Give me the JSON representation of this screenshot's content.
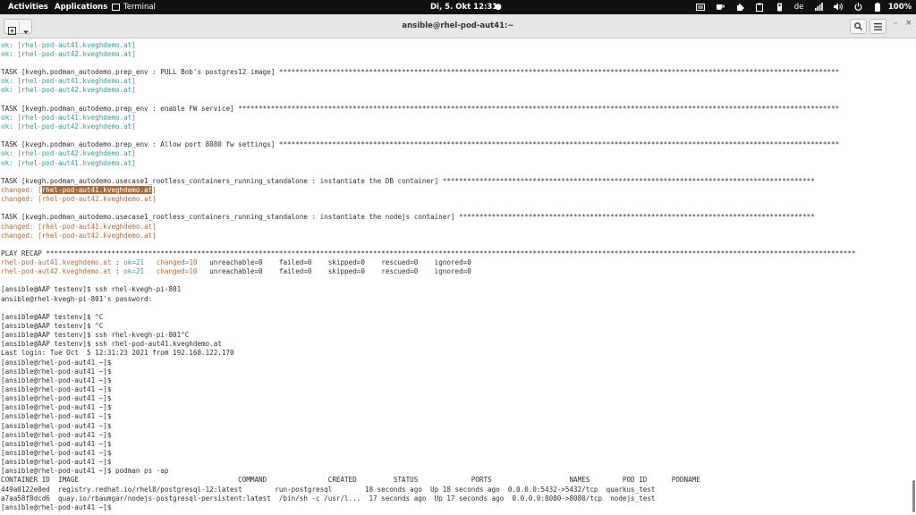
{
  "topbar": {
    "activities": "Activities",
    "applications": "Applications",
    "terminal": "Terminal",
    "clock": "Di, 5. Okt  12:31",
    "dot": "●",
    "lang": "de",
    "battery": "100%"
  },
  "window": {
    "title": "ansible@rhel-pod-aut41:~"
  },
  "terminal": {
    "lines": [
      {
        "segs": [
          {
            "t": "ok: [rhel-pod-aut41.kveghdemo.at]",
            "c": "green"
          }
        ]
      },
      {
        "segs": [
          {
            "t": "ok: [rhel-pod-aut42.kveghdemo.at]",
            "c": "green"
          }
        ]
      },
      {
        "segs": [
          {
            "t": ""
          }
        ]
      },
      {
        "segs": [
          {
            "t": "TASK [kvegh.podman_autodemo.prep_env : PULL Bob's postgres12 image] *****************************************************************************************************************************************"
          }
        ]
      },
      {
        "segs": [
          {
            "t": "ok: [rhel-pod-aut41.kveghdemo.at]",
            "c": "green"
          }
        ]
      },
      {
        "segs": [
          {
            "t": "ok: [rhel-pod-aut42.kveghdemo.at]",
            "c": "green"
          }
        ]
      },
      {
        "segs": [
          {
            "t": ""
          }
        ]
      },
      {
        "segs": [
          {
            "t": "TASK [kvegh.podman_autodemo.prep_env : enable FW service] ***************************************************************************************************************************************************"
          }
        ]
      },
      {
        "segs": [
          {
            "t": "ok: [rhel-pod-aut41.kveghdemo.at]",
            "c": "green"
          }
        ]
      },
      {
        "segs": [
          {
            "t": "ok: [rhel-pod-aut42.kveghdemo.at]",
            "c": "green"
          }
        ]
      },
      {
        "segs": [
          {
            "t": ""
          }
        ]
      },
      {
        "segs": [
          {
            "t": "TASK [kvegh.podman_autodemo.prep_env : Allow port 8080 fw settings] *****************************************************************************************************************************************"
          }
        ]
      },
      {
        "segs": [
          {
            "t": "ok: [rhel-pod-aut42.kveghdemo.at]",
            "c": "green"
          }
        ]
      },
      {
        "segs": [
          {
            "t": "ok: [rhel-pod-aut41.kveghdemo.at]",
            "c": "green"
          }
        ]
      },
      {
        "segs": [
          {
            "t": ""
          }
        ]
      },
      {
        "segs": [
          {
            "t": "TASK [kvegh.podman_autodemo.usecase1_rootless_containers_running_standalone : instantiate the DB container] *******************************************************************************************"
          }
        ]
      },
      {
        "segs": [
          {
            "t": "changed: [",
            "c": "brown"
          },
          {
            "t": "rhel-pod-aut41.kveghdemo.at",
            "c": "sel"
          },
          {
            "t": "]",
            "c": "brown"
          }
        ]
      },
      {
        "segs": [
          {
            "t": "changed: [rhel-pod-aut42.kveghdemo.at]",
            "c": "brown"
          }
        ]
      },
      {
        "segs": [
          {
            "t": ""
          }
        ]
      },
      {
        "segs": [
          {
            "t": "TASK [kvegh.podman_autodemo.usecase1_rootless_containers_running_standalone : instantiate the nodejs container] ***************************************************************************************"
          }
        ]
      },
      {
        "segs": [
          {
            "t": "changed: [rhel-pod-aut41.kveghdemo.at]",
            "c": "brown"
          }
        ]
      },
      {
        "segs": [
          {
            "t": "changed: [rhel-pod-aut42.kveghdemo.at]",
            "c": "brown"
          }
        ]
      },
      {
        "segs": [
          {
            "t": ""
          }
        ]
      },
      {
        "segs": [
          {
            "t": "PLAY RECAP ******************************************************************************************************************************************************************************************************"
          }
        ]
      },
      {
        "segs": [
          {
            "t": "rhel-pod-aut41.kveghdemo.at",
            "c": "brown"
          },
          {
            "t": " : "
          },
          {
            "t": "ok=21",
            "c": "green"
          },
          {
            "t": "   "
          },
          {
            "t": "changed=10",
            "c": "brown"
          },
          {
            "t": "   unreachable=0    failed=0    skipped=0    rescued=0    ignored=0"
          }
        ]
      },
      {
        "segs": [
          {
            "t": "rhel-pod-aut42.kveghdemo.at",
            "c": "brown"
          },
          {
            "t": " : "
          },
          {
            "t": "ok=21",
            "c": "green"
          },
          {
            "t": "   "
          },
          {
            "t": "changed=10",
            "c": "brown"
          },
          {
            "t": "   unreachable=0    failed=0    skipped=0    rescued=0    ignored=0"
          }
        ]
      },
      {
        "segs": [
          {
            "t": ""
          }
        ]
      },
      {
        "segs": [
          {
            "t": "[ansible@AAP testenv]$ ssh rhel-kvegh-pi-801"
          }
        ]
      },
      {
        "segs": [
          {
            "t": "ansible@rhel-kvegh-pi-801's password:"
          }
        ]
      },
      {
        "segs": [
          {
            "t": ""
          }
        ]
      },
      {
        "segs": [
          {
            "t": "[ansible@AAP testenv]$ ^C"
          }
        ]
      },
      {
        "segs": [
          {
            "t": "[ansible@AAP testenv]$ ^C"
          }
        ]
      },
      {
        "segs": [
          {
            "t": "[ansible@AAP testenv]$ ssh rhel-kvegh-pi-801^C"
          }
        ]
      },
      {
        "segs": [
          {
            "t": "[ansible@AAP testenv]$ ssh rhel-pod-aut41.kveghdemo.at"
          }
        ]
      },
      {
        "segs": [
          {
            "t": "Last login: Tue Oct  5 12:31:23 2021 from 192.168.122.170"
          }
        ]
      },
      {
        "segs": [
          {
            "t": "[ansible@rhel-pod-aut41 ~]$"
          }
        ]
      },
      {
        "segs": [
          {
            "t": "[ansible@rhel-pod-aut41 ~]$"
          }
        ]
      },
      {
        "segs": [
          {
            "t": "[ansible@rhel-pod-aut41 ~]$"
          }
        ]
      },
      {
        "segs": [
          {
            "t": "[ansible@rhel-pod-aut41 ~]$"
          }
        ]
      },
      {
        "segs": [
          {
            "t": "[ansible@rhel-pod-aut41 ~]$"
          }
        ]
      },
      {
        "segs": [
          {
            "t": "[ansible@rhel-pod-aut41 ~]$"
          }
        ]
      },
      {
        "segs": [
          {
            "t": "[ansible@rhel-pod-aut41 ~]$"
          }
        ]
      },
      {
        "segs": [
          {
            "t": "[ansible@rhel-pod-aut41 ~]$"
          }
        ]
      },
      {
        "segs": [
          {
            "t": "[ansible@rhel-pod-aut41 ~]$"
          }
        ]
      },
      {
        "segs": [
          {
            "t": "[ansible@rhel-pod-aut41 ~]$"
          }
        ]
      },
      {
        "segs": [
          {
            "t": "[ansible@rhel-pod-aut41 ~]$"
          }
        ]
      },
      {
        "segs": [
          {
            "t": "[ansible@rhel-pod-aut41 ~]$"
          }
        ]
      },
      {
        "segs": [
          {
            "t": "[ansible@rhel-pod-aut41 ~]$ podman ps -ap"
          }
        ]
      },
      {
        "segs": [
          {
            "t": "CONTAINER ID  IMAGE                                       COMMAND               CREATED         STATUS             PORTS                   NAMES        POD ID      PODNAME"
          }
        ]
      },
      {
        "segs": [
          {
            "t": "449a0122e0ed  registry.redhat.io/rhel8/postgresql-12:latest        run-postgresql        18 seconds ago  Up 18 seconds ago  0.0.0.0:5432->5432/tcp  quarkus_test"
          }
        ]
      },
      {
        "segs": [
          {
            "t": "a7aa58f8dcd6  quay.io/rbaumgar/nodejs-postgresql-persistent:latest  /bin/sh -c /usr/l...  17 seconds ago  Up 17 seconds ago  0.0.0.0:8080->8080/tcp  nodejs_test"
          }
        ]
      },
      {
        "segs": [
          {
            "t": "[ansible@rhel-pod-aut41 ~]$"
          }
        ]
      }
    ]
  }
}
